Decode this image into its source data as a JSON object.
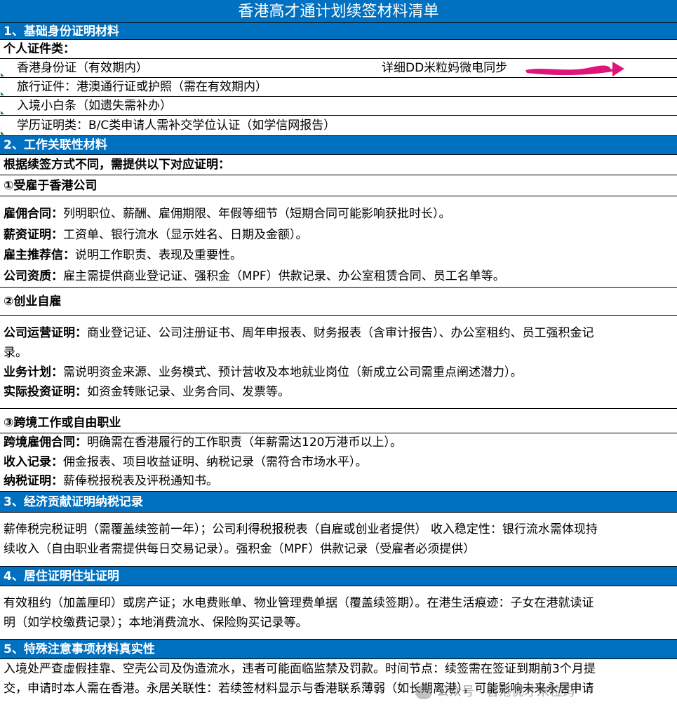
{
  "title": "香港高才通计划续签材料清单",
  "s1": {
    "heading": "1、基础身份证明材料",
    "sub": "个人证件类：",
    "items": [
      "香港身份证（有效期内）",
      "旅行证件：港澳通行证或护照（需在有效期内）",
      "入境小白条（如遗失需补办）",
      "学历证明类：B/C类申请人需补交学位认证（如学信网报告）"
    ],
    "note": "详细DD米粒妈微电同步"
  },
  "s2": {
    "heading": "2、工作关联性材料",
    "intro": "根据续签方式不同，需提供以下对应证明：",
    "g1": {
      "title": "①受雇于香港公司",
      "lines": [
        {
          "k": "雇佣合同：",
          "v": "列明职位、薪酬、雇佣期限、年假等细节（短期合同可能影响获批时长）。"
        },
        {
          "k": "薪资证明：",
          "v": "工资单、银行流水（显示姓名、日期及金额）。"
        },
        {
          "k": "雇主推荐信：",
          "v": "说明工作职责、表现及重要性。"
        },
        {
          "k": "公司资质：",
          "v": "雇主需提供商业登记证、强积金（MPF）供款记录、办公室租赁合同、员工名单等。"
        }
      ]
    },
    "g2": {
      "title": "②创业自雇",
      "l1k": "公司运营证明：",
      "l1a": "商业登记证、公司注册证书、周年申报表、财务报表（含审计报告）、办公室租约、员工强积金记",
      "l1b": "录。",
      "l2k": "业务计划：",
      "l2v": "需说明资金来源、业务模式、预计营收及本地就业岗位（新成立公司需重点阐述潜力）。",
      "l3k": "实际投资证明：",
      "l3v": "如资金转账记录、业务合同、发票等。"
    },
    "g3": {
      "title": "③跨境工作或自由职业",
      "lines": [
        {
          "k": "跨境雇佣合同：",
          "v": "明确需在香港履行的工作职责（年薪需达120万港币以上）。"
        },
        {
          "k": "收入记录：",
          "v": "佣金报表、项目收益证明、纳税记录（需符合市场水平）。"
        },
        {
          "k": "纳税证明：",
          "v": "薪俸税报税表及评税通知书。"
        }
      ]
    }
  },
  "s3": {
    "heading": "3、经济贡献证明纳税记录",
    "l1": "薪俸税完税证明（需覆盖续签前一年）；公司利得税报税表（自雇或创业者提供） 收入稳定性：银行流水需体现持",
    "l2": "续收入（自由职业者需提供每日交易记录）。强积金（MPF）供款记录（受雇者必须提供）"
  },
  "s4": {
    "heading": "4、居住证明住址证明",
    "l1": "有效租约（加盖厘印）或房产证；水电费账单、物业管理费单据（覆盖续签期）。在港生活痕迹：子女在港就读证",
    "l2": "明（如学校缴费记录）；本地消费流水、保险购买记录等。"
  },
  "s5": {
    "heading": "5、特殊注意事项材料真实性",
    "l1": "入境处严查虚假挂靠、空壳公司及伪造流水，违者可能面临监禁及罚款。时间节点：续签需在签证到期前3个月提",
    "l2": "交，申请时本人需在香港。永居关联性：若续签材料显示与香港联系薄弱（如长期离港），可能影响未来永居申请"
  },
  "watermark": "公众号 · 香港优才米粒妈",
  "colors": {
    "header_blue": "#0070c0",
    "scribble": "#e0157a",
    "corner_mark": "#1e7e34"
  }
}
